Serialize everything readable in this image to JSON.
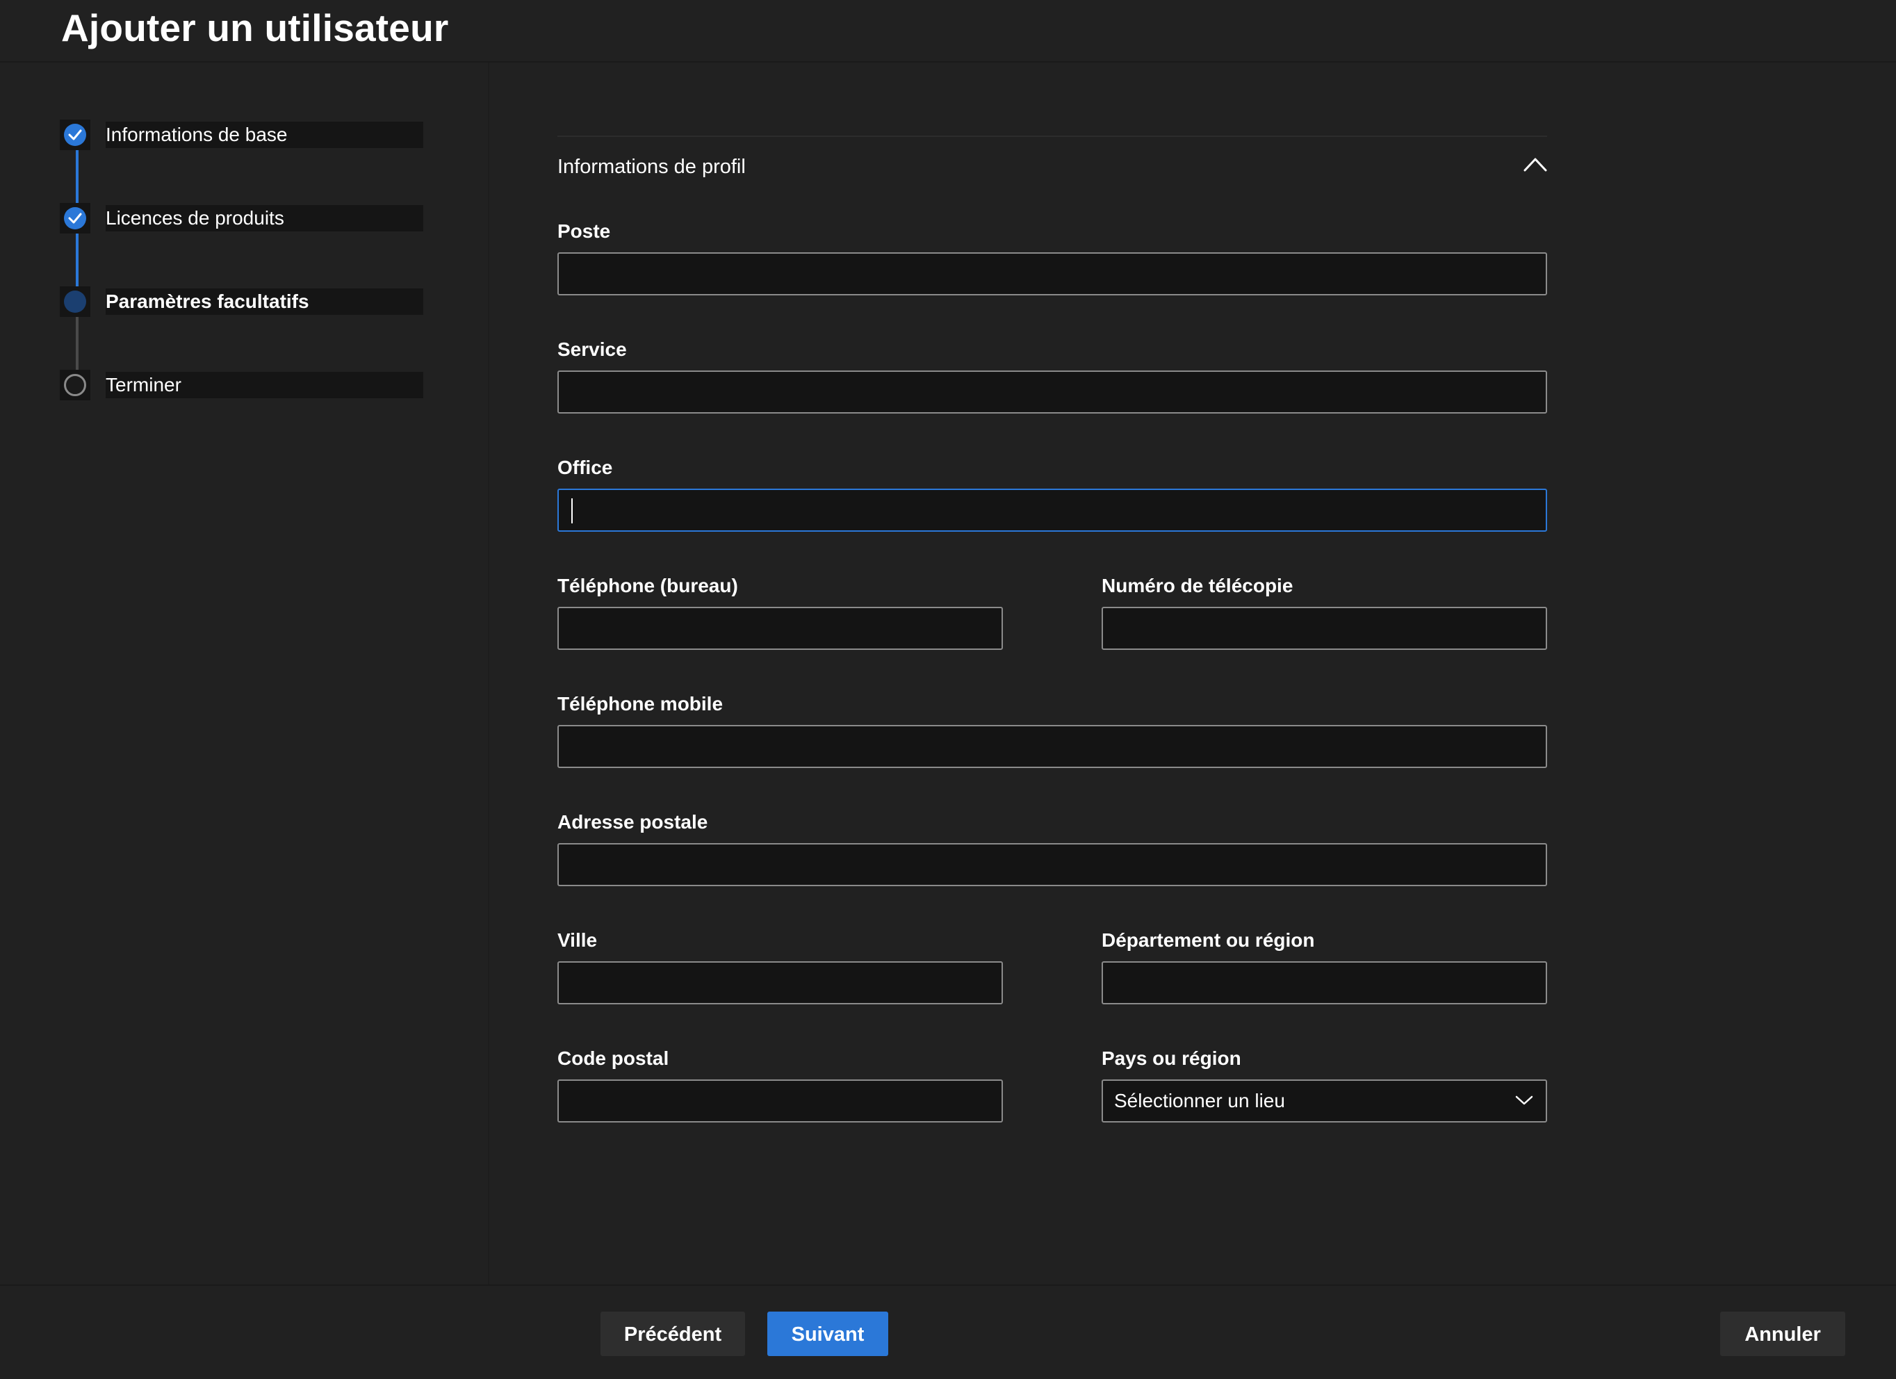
{
  "header": {
    "title": "Ajouter un utilisateur"
  },
  "wizard": {
    "steps": [
      {
        "label": "Informations de base",
        "state": "completed"
      },
      {
        "label": "Licences de produits",
        "state": "completed"
      },
      {
        "label": "Paramètres facultatifs",
        "state": "current"
      },
      {
        "label": "Terminer",
        "state": "pending"
      }
    ]
  },
  "profile": {
    "section_title": "Informations de profil",
    "collapse_icon": "chevron-up-icon",
    "fields": {
      "poste": {
        "label": "Poste",
        "value": ""
      },
      "service": {
        "label": "Service",
        "value": ""
      },
      "office": {
        "label": "Office",
        "value": ""
      },
      "telephone_bureau": {
        "label": "Téléphone (bureau)",
        "value": ""
      },
      "fax": {
        "label": "Numéro de télécopie",
        "value": ""
      },
      "mobile": {
        "label": "Téléphone mobile",
        "value": ""
      },
      "adresse": {
        "label": "Adresse postale",
        "value": ""
      },
      "ville": {
        "label": "Ville",
        "value": ""
      },
      "departement": {
        "label": "Département ou région",
        "value": ""
      },
      "code_postal": {
        "label": "Code postal",
        "value": ""
      },
      "pays": {
        "label": "Pays ou région",
        "selected": "Sélectionner un lieu"
      }
    }
  },
  "footer": {
    "previous_label": "Précédent",
    "next_label": "Suivant",
    "cancel_label": "Annuler"
  },
  "colors": {
    "background": "#212121",
    "accent": "#2b78d8",
    "input_background": "#141414",
    "input_border": "#8b8b8b"
  }
}
